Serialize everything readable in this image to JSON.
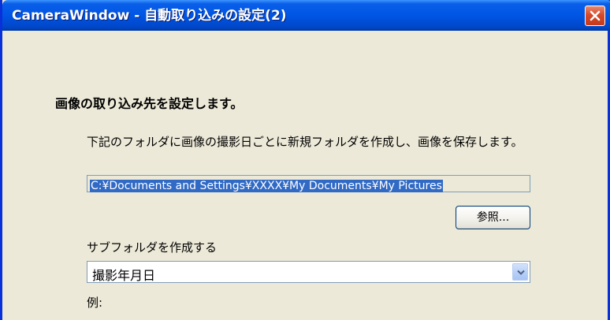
{
  "window": {
    "title": "CameraWindow - 自動取り込みの設定(2)"
  },
  "content": {
    "heading": "画像の取り込み先を設定します。",
    "description": "下記のフォルダに画像の撮影日ごとに新規フォルダを作成し、画像を保存します。",
    "path_value": "C:¥Documents and Settings¥XXXX¥My Documents¥My Pictures",
    "browse_label": "参照...",
    "subfolder_label": "サブフォルダを作成する",
    "subfolder_selected": "撮影年月日",
    "example_label": "例:"
  },
  "icons": {
    "close": "close-icon",
    "dropdown": "chevron-down-icon"
  },
  "colors": {
    "titlebar": "#0055e5",
    "window_bg": "#ece9d8",
    "selection": "#316ac5",
    "close_button": "#d6492a"
  }
}
